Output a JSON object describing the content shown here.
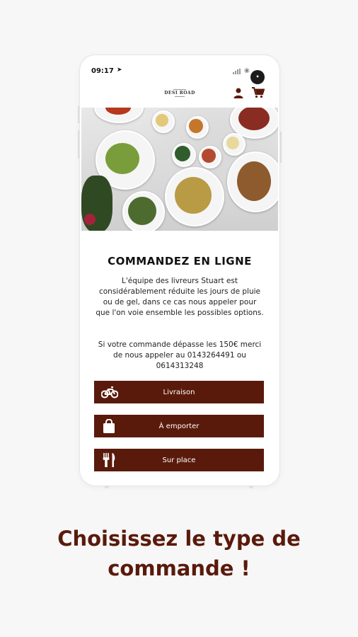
{
  "status": {
    "time": "09:17",
    "avatar_initial": "•"
  },
  "brand": {
    "logo_text": "DESI ROAD",
    "accent_color": "#5a1a0b"
  },
  "header_icons": [
    "user-icon",
    "cart-icon"
  ],
  "main": {
    "title": "COMMANDEZ EN LIGNE",
    "paragraph1": "L'équipe des livreurs Stuart est considérablement réduite les jours de pluie ou de gel, dans ce cas nous appeler pour que l'on voie ensemble les possibles options.",
    "paragraph2": "Si votre commande dépasse les 150€ merci de nous appeler au 0143264491 ou 0614313248"
  },
  "order_types": [
    {
      "label": "Livraison",
      "icon": "bicycle-icon"
    },
    {
      "label": "À emporter",
      "icon": "shopping-bag-icon"
    },
    {
      "label": "Sur place",
      "icon": "fork-knife-icon"
    }
  ],
  "caption": {
    "line1": "Choisissez le type de",
    "line2": "commande !"
  }
}
